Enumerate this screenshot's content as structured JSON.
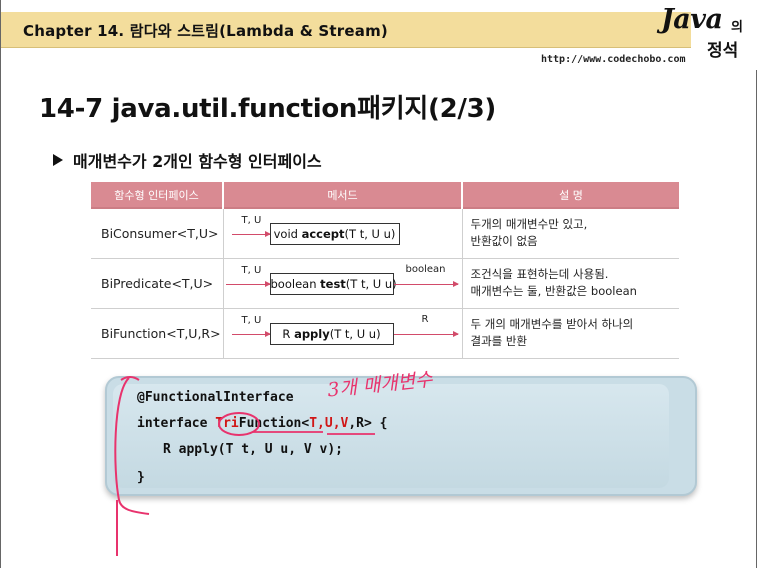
{
  "header": {
    "chapter": "Chapter 14. 람다와 스트림(Lambda & Stream)",
    "brand_java": "Java",
    "brand_ui": "의",
    "brand_jeongseok": "정석",
    "url": "http://www.codechobo.com"
  },
  "title": "14-7 java.util.function패키지(2/3)",
  "subheading": "매개변수가 2개인 함수형 인터페이스",
  "table": {
    "headers": [
      "함수형 인터페이스",
      "메서드",
      "설 명"
    ],
    "rows": [
      {
        "iface": "BiConsumer<T,U>",
        "in_label": "T, U",
        "method_prefix": "void ",
        "method_name": "accept",
        "method_suffix": "(T t, U u)",
        "out_label": "",
        "desc1": "두개의 매개변수만 있고,",
        "desc2": "반환값이 없음"
      },
      {
        "iface": "BiPredicate<T,U>",
        "in_label": "T, U",
        "method_prefix": "boolean ",
        "method_name": "test",
        "method_suffix": "(T t, U u)",
        "out_label": "boolean",
        "desc1": "조건식을 표현하는데 사용됨.",
        "desc2": "매개변수는 둘, 반환값은 boolean"
      },
      {
        "iface": "BiFunction<T,U,R>",
        "in_label": "T, U",
        "method_prefix": "R ",
        "method_name": "apply",
        "method_suffix": "(T t, U u)",
        "out_label": "R",
        "desc1": "두 개의 매개변수를 받아서 하나의",
        "desc2": "결과를 반환"
      }
    ]
  },
  "code": {
    "line1": "@FunctionalInterface",
    "line2_a": "interface ",
    "line2_tri": "Tri",
    "line2_b": "Function<",
    "line2_tuv": "T,U,V",
    "line2_c": ",R> {",
    "line3": "R apply(T t, U u, V v);",
    "line4": "}"
  },
  "annotation": "3개 매개변수",
  "colors": {
    "header_band": "#f3dd9c",
    "table_header": "#d98a92",
    "code_bg": "#c9dde6",
    "ink": "#e8336d",
    "code_red": "#d01616"
  }
}
